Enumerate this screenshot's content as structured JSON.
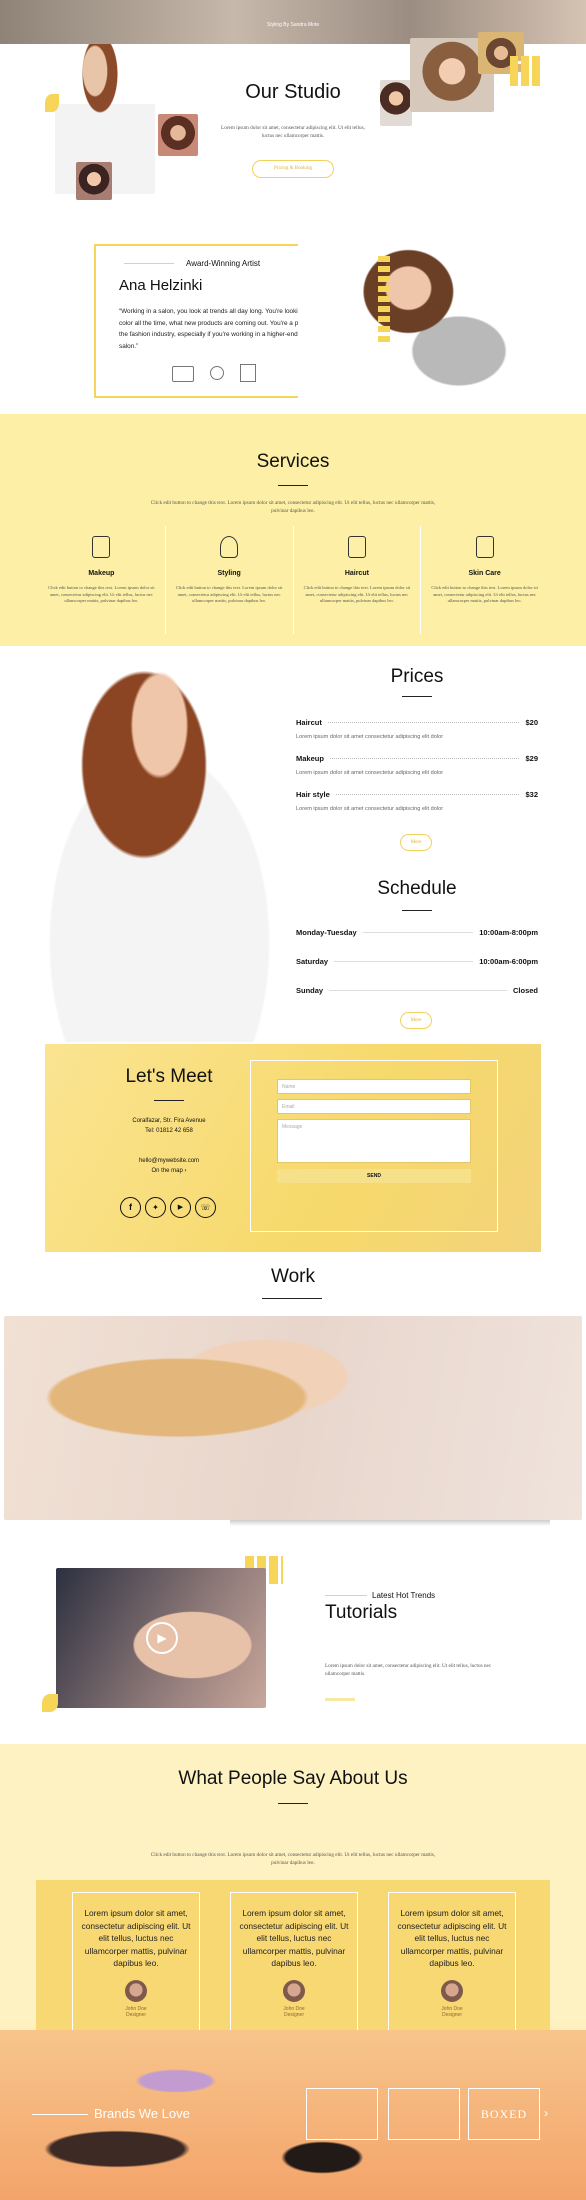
{
  "hero": {
    "caption": "Styling By Sandra Mote"
  },
  "studio": {
    "title": "Our Studio",
    "text": "Lorem ipsum dolor sit amet, consectetur adipiscing elit. Ut elit tellus, luctus nec ullamcorper mattis.",
    "button": "Pricing & Booking"
  },
  "artist": {
    "tag": "Award-Winning Artist",
    "name": "Ana Helzinki",
    "quote": "“Working in a salon, you look at trends all day long. You're looking at color all the time, what new products are coming out. You're a part of the fashion industry, especially if you're working in a higher-end salon.”"
  },
  "services": {
    "title": "Services",
    "text": "Click edit button to change this text. Lorem ipsum dolor sit amet, consectetur adipiscing elit. Ut elit tellus, luctus nec ullamcorper mattis, pulvinar dapibus leo.",
    "items": [
      {
        "name": "Makeup",
        "icon": "lipstick-icon",
        "text": "Click edit button to change this text. Lorem ipsum dolor sit amet, consectetur adipiscing elit. Ut elit tellus, luctus nec ullamcorper mattis, pulvinar dapibus leo."
      },
      {
        "name": "Styling",
        "icon": "hair-styling-icon",
        "text": "Click edit button to change this text. Lorem ipsum dolor sit amet, consectetur adipiscing elit. Ut elit tellus, luctus nec ullamcorper mattis, pulvinar dapibus leo."
      },
      {
        "name": "Haircut",
        "icon": "scissors-icon",
        "text": "Click edit button to change this text. Lorem ipsum dolor sit amet, consectetur adipiscing elit. Ut elit tellus, luctus nec ullamcorper mattis, pulvinar dapibus leo."
      },
      {
        "name": "Skin Care",
        "icon": "skincare-icon",
        "text": "Click edit button to change this text. Lorem ipsum dolor sit amet, consectetur adipiscing elit. Ut elit tellus, luctus nec ullamcorper mattis, pulvinar dapibus leo."
      }
    ]
  },
  "prices": {
    "title": "Prices",
    "items": [
      {
        "name": "Haircut",
        "price": "$20",
        "desc": "Lorem ipsum dolor sit amet consectetur adipiscing elit dolor"
      },
      {
        "name": "Makeup",
        "price": "$29",
        "desc": "Lorem ipsum dolor sit amet consectetur adipiscing elit dolor"
      },
      {
        "name": "Hair style",
        "price": "$32",
        "desc": "Lorem ipsum dolor sit amet consectetur adipiscing elit dolor"
      }
    ],
    "button": "More"
  },
  "schedule": {
    "title": "Schedule",
    "rows": [
      {
        "day": "Monday-Tuesday",
        "hours": "10:00am-8:00pm"
      },
      {
        "day": "Saturday",
        "hours": "10:00am-6:00pm"
      },
      {
        "day": "Sunday",
        "hours": "Closed"
      }
    ],
    "button": "More"
  },
  "meet": {
    "title": "Let's Meet",
    "address": "Coralfazar, Str. Fira Avenue",
    "tel": "Tel: 01812 42 658",
    "email": "hello@mywebsite.com",
    "map": "On the map ›",
    "form": {
      "name": "Name",
      "email": "Email",
      "message": "Message",
      "send": "SEND"
    }
  },
  "work": {
    "title": "Work"
  },
  "tutorials": {
    "tag": "Latest Hot Trends",
    "title": "Tutorials",
    "text": "Lorem ipsum dolor sit amet, consectetur adipiscing elit. Ut elit tellus, luctus nec ullamcorper mattis."
  },
  "testimonials": {
    "title": "What People Say About Us",
    "text": "Click edit button to change this text. Lorem ipsum dolor sit amet, consectetur adipiscing elit. Ut elit tellus, luctus nec ullamcorper mattis, pulvinar dapibus leo.",
    "items": [
      {
        "quote": "Lorem ipsum dolor sit amet, consectetur adipiscing elit. Ut elit tellus, luctus nec ullamcorper mattis, pulvinar dapibus leo.",
        "name": "John Doe",
        "role": "Designer"
      },
      {
        "quote": "Lorem ipsum dolor sit amet, consectetur adipiscing elit. Ut elit tellus, luctus nec ullamcorper mattis, pulvinar dapibus leo.",
        "name": "John Doe",
        "role": "Designer"
      },
      {
        "quote": "Lorem ipsum dolor sit amet, consectetur adipiscing elit. Ut elit tellus, luctus nec ullamcorper mattis, pulvinar dapibus leo.",
        "name": "John Doe",
        "role": "Designer"
      }
    ]
  },
  "brands": {
    "title": "Brands We Love",
    "logo": "BOXED"
  },
  "colors": {
    "accent": "#f6d558",
    "pale": "#fdf0a6",
    "cream": "#fff5c7"
  }
}
